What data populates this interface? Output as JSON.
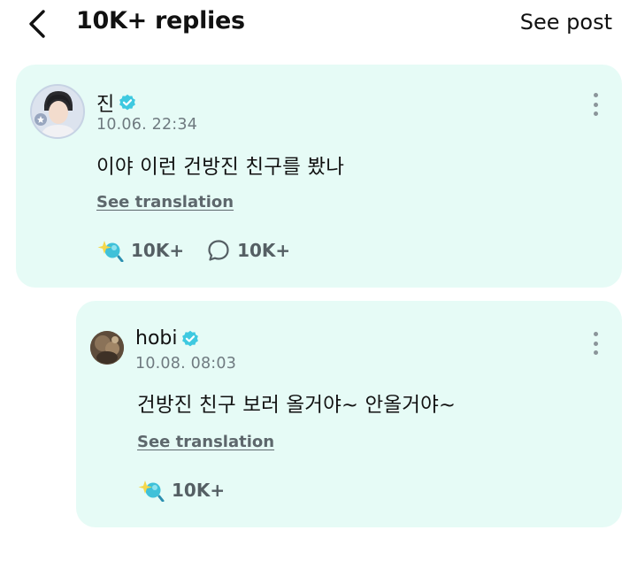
{
  "header": {
    "title": "10K+ replies",
    "see_post_label": "See post"
  },
  "post": {
    "author": "진",
    "date": "10.06. 22:34",
    "text": "이야 이런 건방진 친구를 봤나",
    "translation_label": "See translation",
    "likes": "10K+",
    "comments": "10K+"
  },
  "reply": {
    "author": "hobi",
    "date": "10.08. 08:03",
    "text": "건방진 친구 보러 올거야~ 안올거야~",
    "translation_label": "See translation",
    "likes": "10K+"
  },
  "icons": {
    "back": "chevron-left-icon",
    "verified": "verified-badge-icon",
    "reaction": "sparkle-reaction-icon",
    "comment": "comment-bubble-icon",
    "more": "more-vertical-icon"
  },
  "colors": {
    "card_bg": "#e6fbf6",
    "verified": "#3ec9e0",
    "reaction_teal": "#3fc1d9",
    "reaction_yellow": "#f5d74a",
    "muted_text": "#6f7a80"
  }
}
